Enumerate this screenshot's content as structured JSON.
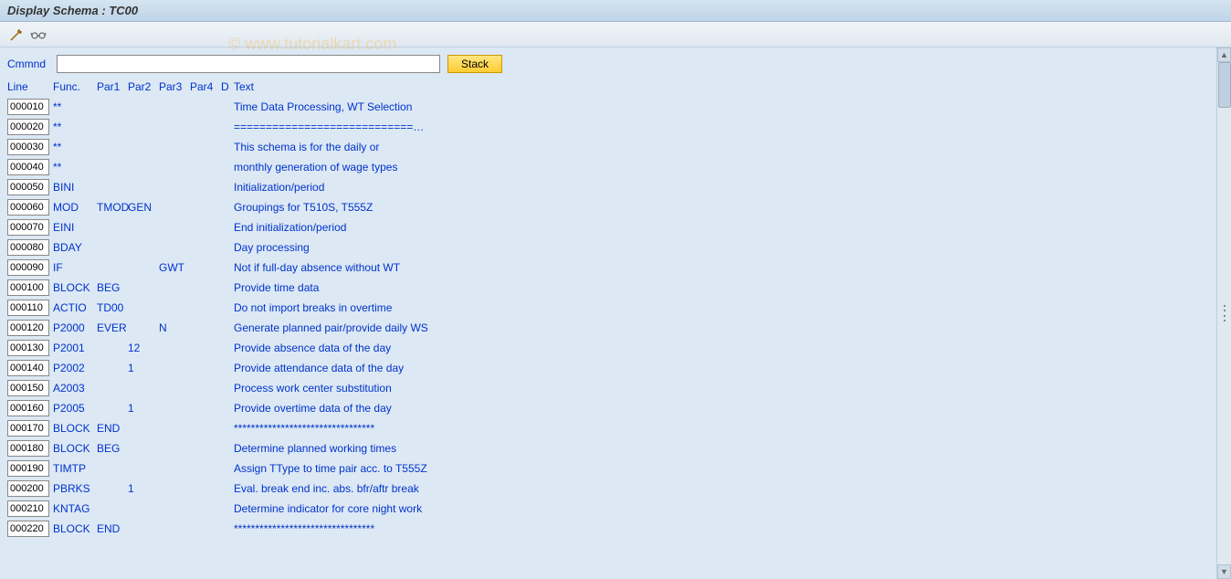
{
  "title": "Display Schema : TC00",
  "watermark": "© www.tutorialkart.com",
  "command": {
    "label": "Cmmnd",
    "value": "",
    "stack_label": "Stack"
  },
  "headers": {
    "line": "Line",
    "func": "Func.",
    "par1": "Par1",
    "par2": "Par2",
    "par3": "Par3",
    "par4": "Par4",
    "d": "D",
    "text": "Text"
  },
  "rows": [
    {
      "line": "000010",
      "func": "**",
      "par1": "",
      "par2": "",
      "par3": "",
      "par4": "",
      "d": "",
      "text": "Time Data Processing, WT Selection"
    },
    {
      "line": "000020",
      "func": "**",
      "par1": "",
      "par2": "",
      "par3": "",
      "par4": "",
      "d": "",
      "text": "============================…"
    },
    {
      "line": "000030",
      "func": "**",
      "par1": "",
      "par2": "",
      "par3": "",
      "par4": "",
      "d": "",
      "text": "This schema is for the daily or"
    },
    {
      "line": "000040",
      "func": "**",
      "par1": "",
      "par2": "",
      "par3": "",
      "par4": "",
      "d": "",
      "text": "monthly generation of wage types"
    },
    {
      "line": "000050",
      "func": "BINI",
      "par1": "",
      "par2": "",
      "par3": "",
      "par4": "",
      "d": "",
      "text": "Initialization/period"
    },
    {
      "line": "000060",
      "func": "MOD",
      "par1": "TMOD",
      "par2": "GEN",
      "par3": "",
      "par4": "",
      "d": "",
      "text": "Groupings for T510S, T555Z"
    },
    {
      "line": "000070",
      "func": "EINI",
      "par1": "",
      "par2": "",
      "par3": "",
      "par4": "",
      "d": "",
      "text": "End initialization/period"
    },
    {
      "line": "000080",
      "func": "BDAY",
      "par1": "",
      "par2": "",
      "par3": "",
      "par4": "",
      "d": "",
      "text": "Day processing"
    },
    {
      "line": "000090",
      "func": "IF",
      "par1": "",
      "par2": "",
      "par3": "GWT",
      "par4": "",
      "d": "",
      "text": "Not if full-day absence without WT"
    },
    {
      "line": "000100",
      "func": "BLOCK",
      "par1": "BEG",
      "par2": "",
      "par3": "",
      "par4": "",
      "d": "",
      "text": "Provide time data"
    },
    {
      "line": "000110",
      "func": "ACTIO",
      "par1": "TD00",
      "par2": "",
      "par3": "",
      "par4": "",
      "d": "",
      "text": "Do not import breaks in overtime"
    },
    {
      "line": "000120",
      "func": "P2000",
      "par1": "EVER",
      "par2": "",
      "par3": "N",
      "par4": "",
      "d": "",
      "text": "Generate planned pair/provide daily WS"
    },
    {
      "line": "000130",
      "func": "P2001",
      "par1": "",
      "par2": "12",
      "par3": "",
      "par4": "",
      "d": "",
      "text": "Provide absence data of the day"
    },
    {
      "line": "000140",
      "func": "P2002",
      "par1": "",
      "par2": "1",
      "par3": "",
      "par4": "",
      "d": "",
      "text": "Provide attendance data of the day"
    },
    {
      "line": "000150",
      "func": "A2003",
      "par1": "",
      "par2": "",
      "par3": "",
      "par4": "",
      "d": "",
      "text": "Process work center substitution"
    },
    {
      "line": "000160",
      "func": "P2005",
      "par1": "",
      "par2": "1",
      "par3": "",
      "par4": "",
      "d": "",
      "text": "Provide overtime data of the day"
    },
    {
      "line": "000170",
      "func": "BLOCK",
      "par1": "END",
      "par2": "",
      "par3": "",
      "par4": "",
      "d": "",
      "text": "*********************************"
    },
    {
      "line": "000180",
      "func": "BLOCK",
      "par1": "BEG",
      "par2": "",
      "par3": "",
      "par4": "",
      "d": "",
      "text": "Determine planned working times"
    },
    {
      "line": "000190",
      "func": "TIMTP",
      "par1": "",
      "par2": "",
      "par3": "",
      "par4": "",
      "d": "",
      "text": "Assign TType to time pair acc. to T555Z"
    },
    {
      "line": "000200",
      "func": "PBRKS",
      "par1": "",
      "par2": "1",
      "par3": "",
      "par4": "",
      "d": "",
      "text": "Eval. break end inc. abs. bfr/aftr break"
    },
    {
      "line": "000210",
      "func": "KNTAG",
      "par1": "",
      "par2": "",
      "par3": "",
      "par4": "",
      "d": "",
      "text": "Determine indicator for core night work"
    },
    {
      "line": "000220",
      "func": "BLOCK",
      "par1": "END",
      "par2": "",
      "par3": "",
      "par4": "",
      "d": "",
      "text": "*********************************"
    }
  ]
}
